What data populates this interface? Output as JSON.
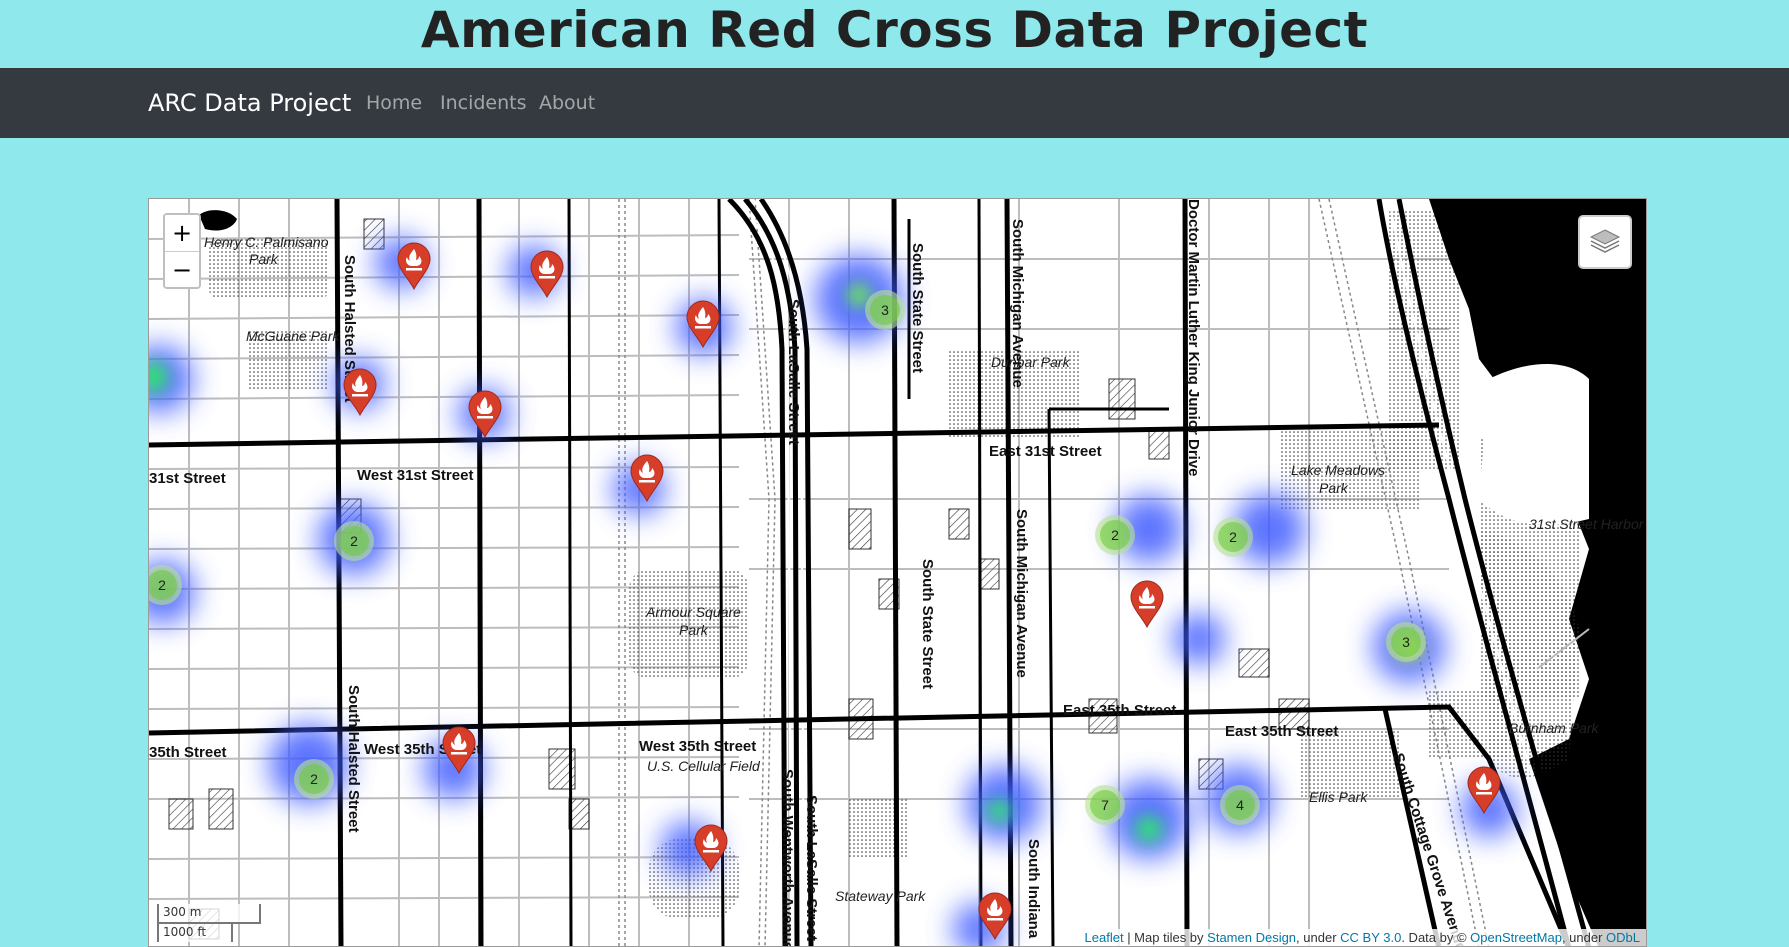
{
  "page": {
    "title": "American Red Cross Data Project"
  },
  "navbar": {
    "brand": "ARC Data Project",
    "links": [
      "Home",
      "Incidents",
      "About"
    ],
    "background": "#343A40"
  },
  "colors": {
    "page_bg": "#8EE8EC",
    "marker": "#D63E2A",
    "cluster": "#6ECC39",
    "heat": "#3F5BFF"
  },
  "map": {
    "zoom_in_label": "+",
    "zoom_out_label": "−",
    "layers_icon": "layers-icon",
    "scale": {
      "metric": "300 m",
      "imperial": "1000 ft"
    },
    "attribution": {
      "leaflet": "Leaflet",
      "sep1": " | Map tiles by ",
      "stamen": "Stamen Design",
      "sep2": ", under ",
      "cc": "CC BY 3.0",
      "sep3": ". Data by © ",
      "osm": "OpenStreetMap",
      "sep4": ", under ",
      "odbl": "ODbL"
    },
    "street_labels": [
      "Henry C. Palmisano",
      "Park",
      "McGuane Park",
      "South Halsted Street",
      "West 31st Street",
      "31st Street",
      "South LaSalle Street",
      "South State Street",
      "South Michigan Avenue",
      "Doctor Martin Luther King Junior Drive",
      "Dunbar Park",
      "East 31st Street",
      "Lake Meadows",
      "Park",
      "31st Street Harbor",
      "Armour Square",
      "Park",
      "East 35th Street",
      "East 35th Street",
      "West 35th Street",
      "U.S. Cellular Field",
      "West 35th Street",
      "35th Street",
      "Burnham Park",
      "Ellis Park",
      "South Cottage Grove Avenue",
      "South Wentworth Avenue",
      "South LaSalle Street",
      "Stateway Park",
      "South Indiana"
    ],
    "clusters": [
      {
        "count": "3"
      },
      {
        "count": "2"
      },
      {
        "count": "2"
      },
      {
        "count": "2"
      },
      {
        "count": "2"
      },
      {
        "count": "3"
      },
      {
        "count": "2"
      },
      {
        "count": "7"
      },
      {
        "count": "4"
      }
    ],
    "marker_icon": "fire-icon"
  }
}
